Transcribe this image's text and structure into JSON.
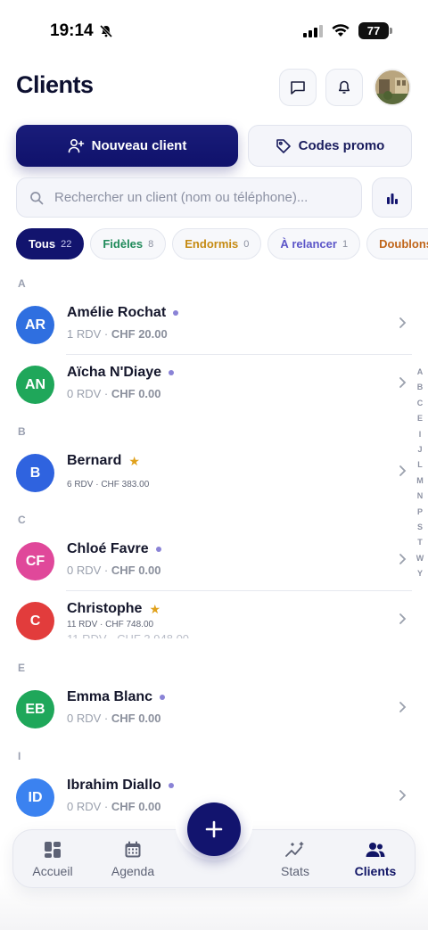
{
  "status_bar": {
    "time": "19:14",
    "battery": "77"
  },
  "header": {
    "title": "Clients"
  },
  "actions": {
    "new_client": "Nouveau client",
    "promo_codes": "Codes promo"
  },
  "search": {
    "placeholder": "Rechercher un client (nom ou téléphone)..."
  },
  "filters": [
    {
      "label": "Tous",
      "count": "22",
      "color": "#ffffff"
    },
    {
      "label": "Fidèles",
      "count": "8",
      "color": "#1f8a5a"
    },
    {
      "label": "Endormis",
      "count": "0",
      "color": "#c58a12"
    },
    {
      "label": "À relancer",
      "count": "1",
      "color": "#5b55c8"
    },
    {
      "label": "Doublons",
      "count": "",
      "color": "#c0651a"
    }
  ],
  "sections": [
    "A",
    "B",
    "C",
    "E",
    "I"
  ],
  "clients": [
    {
      "initials": "AR",
      "name": "Amélie Rochat",
      "meta_rdv": "1 RDV",
      "meta_amount": "CHF 20.00",
      "badge": "dot",
      "avatar_color": "#2f6fe0"
    },
    {
      "initials": "AN",
      "name": "Aïcha N'Diaye",
      "meta_rdv": "0 RDV",
      "meta_amount": "CHF 0.00",
      "badge": "dot",
      "avatar_color": "#1fa75a"
    },
    {
      "initials": "B",
      "name": "Bernard",
      "meta_full": "6 RDV · CHF 383.00",
      "badge": "star",
      "avatar_color": "#2f63df"
    },
    {
      "initials": "CF",
      "name": "Chloé Favre",
      "meta_rdv": "0 RDV",
      "meta_amount": "CHF 0.00",
      "badge": "dot",
      "avatar_color": "#e0489a"
    },
    {
      "initials": "C",
      "name": "Christophe",
      "meta_full": "11 RDV · CHF 748.00",
      "ghost_meta": "11 RDV · CHF 3 948.00",
      "badge": "star",
      "avatar_color": "#e23c3c"
    },
    {
      "initials": "EB",
      "name": "Emma Blanc",
      "meta_rdv": "0 RDV",
      "meta_amount": "CHF 0.00",
      "badge": "dot",
      "avatar_color": "#1fa75a"
    },
    {
      "initials": "ID",
      "name": "Ibrahim Diallo",
      "meta_rdv": "0 RDV",
      "meta_amount": "CHF 0.00",
      "badge": "dot",
      "avatar_color": "#3b82f0"
    }
  ],
  "alpha_index": [
    "A",
    "B",
    "C",
    "E",
    "I",
    "J",
    "L",
    "M",
    "N",
    "P",
    "S",
    "T",
    "W",
    "Y"
  ],
  "nav": {
    "home": "Accueil",
    "agenda": "Agenda",
    "stats": "Stats",
    "clients": "Clients"
  },
  "colors": {
    "primary": "#12146e",
    "dot": "#8a83d6",
    "star": "#e0a11b"
  }
}
